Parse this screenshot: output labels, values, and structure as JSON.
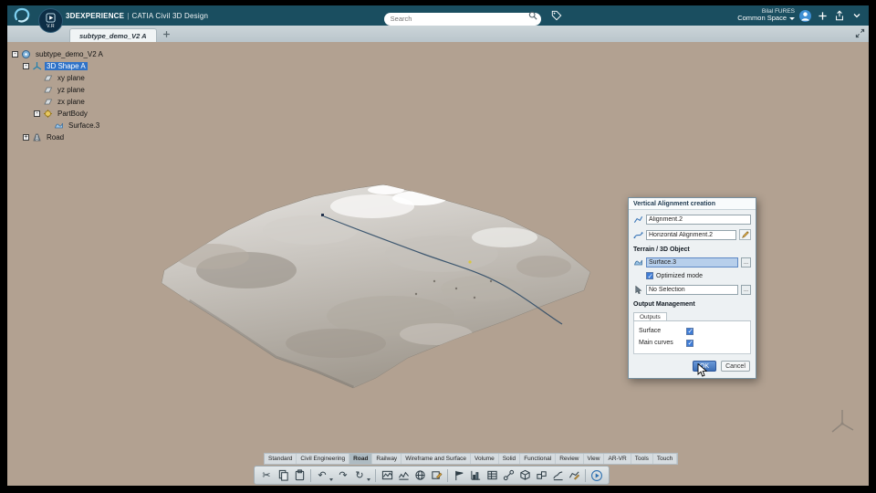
{
  "topbar": {
    "brand": "3DEXPERIENCE",
    "divider": "|",
    "app_name": "CATIA Civil 3D Design",
    "search_placeholder": "Search",
    "user_name": "Bilal FURES",
    "space_label": "Common Space",
    "app_badge_label": "V.R"
  },
  "tabbar": {
    "active_tab": "subtype_demo_V2 A"
  },
  "tree": {
    "items": [
      {
        "label": "subtype_demo_V2 A"
      },
      {
        "label": "3D Shape A"
      },
      {
        "label": "xy plane"
      },
      {
        "label": "yz plane"
      },
      {
        "label": "zx plane"
      },
      {
        "label": "PartBody"
      },
      {
        "label": "Surface.3"
      },
      {
        "label": "Road"
      }
    ],
    "selected_item": "3D Shape A"
  },
  "dialog": {
    "title": "Vertical Alignment creation",
    "alignment_value": "Alignment.2",
    "horizontal_alignment_value": "Horizontal Alignment.2",
    "terrain_section_title": "Terrain / 3D Object",
    "surface_value": "Surface.3",
    "optimized_mode_label": "Optimized mode",
    "optimized_mode_checked": true,
    "selection_value": "No Selection",
    "output_section_title": "Output Management",
    "outputs_tab_label": "Outputs",
    "output_surface_label": "Surface",
    "output_surface_checked": true,
    "output_main_curves_label": "Main curves",
    "output_main_curves_checked": true,
    "ok_label": "OK",
    "cancel_label": "Cancel",
    "browse_label": "..."
  },
  "ribbon": {
    "tabs": [
      "Standard",
      "Civil Engineering",
      "Road",
      "Railway",
      "Wireframe and Surface",
      "Volume",
      "Solid",
      "Functional",
      "Review",
      "View",
      "AR-VR",
      "Tools",
      "Touch"
    ],
    "active_tab": "Road"
  },
  "icon_glyphs": {
    "cut": "✂",
    "undo": "↶",
    "redo": "↷",
    "update": "↻"
  },
  "toolbar_icons": [
    "cut",
    "copy",
    "paste",
    "undo",
    "redo",
    "update",
    "profile-chart",
    "wave-chart",
    "globe",
    "sketch",
    "flag",
    "analysis-chart",
    "table",
    "link",
    "solids",
    "volume",
    "section-chart",
    "surface-edit",
    "play"
  ],
  "colors": {
    "topbar_bg": "#1a4e60",
    "selection_blue": "#2e72c8",
    "checkbox_blue": "#3e7cd6",
    "ok_blue": "#3e6fb5",
    "viewport_bg": "#b2a191"
  }
}
